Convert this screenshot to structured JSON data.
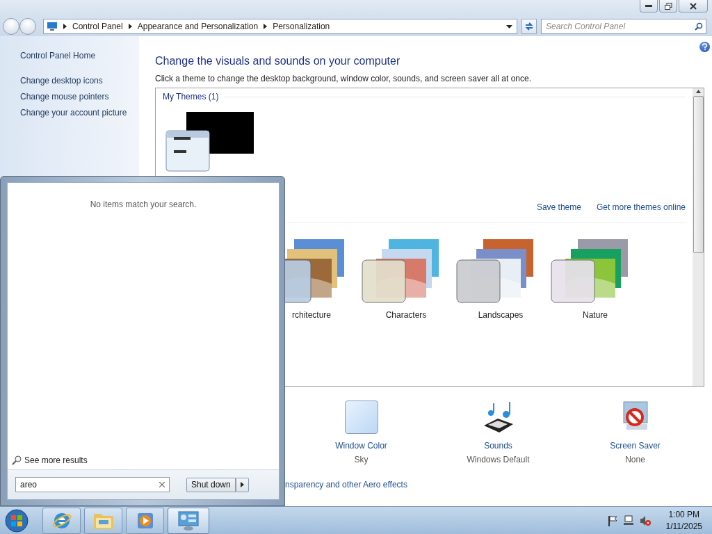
{
  "address_bar": {
    "breadcrumbs": [
      "Control Panel",
      "Appearance and Personalization",
      "Personalization"
    ]
  },
  "search": {
    "placeholder": "Search Control Panel"
  },
  "sidebar": {
    "items": [
      "Control Panel Home",
      "Change desktop icons",
      "Change mouse pointers",
      "Change your account picture"
    ]
  },
  "main": {
    "title": "Change the visuals and sounds on your computer",
    "subtitle": "Click a theme to change the desktop background, window color, sounds, and screen saver all at once."
  },
  "my_themes": {
    "heading": "My Themes (1)",
    "links": [
      "Save theme",
      "Get more themes online"
    ]
  },
  "aero_themes": [
    {
      "name": "rchitecture"
    },
    {
      "name": "Characters"
    },
    {
      "name": "Landscapes"
    },
    {
      "name": "Nature"
    }
  ],
  "settings": [
    {
      "kind": "swatch",
      "label": "Window Color",
      "value": "Sky"
    },
    {
      "kind": "sounds",
      "label": "Sounds",
      "value": "Windows Default"
    },
    {
      "kind": "screensaver",
      "label": "Screen Saver",
      "value": "None"
    }
  ],
  "aero_link": "nsparency and other Aero effects",
  "start_menu": {
    "message": "No items match your search.",
    "more": "See more results",
    "search_value": "areo",
    "shutdown": "Shut down"
  },
  "taskbar": {
    "apps": [
      {
        "kind": "browser",
        "selected": false
      },
      {
        "kind": "folder",
        "selected": false
      },
      {
        "kind": "media",
        "selected": false
      },
      {
        "kind": "control",
        "selected": true
      }
    ],
    "time": "1:00 PM",
    "date": "1/11/2025"
  }
}
